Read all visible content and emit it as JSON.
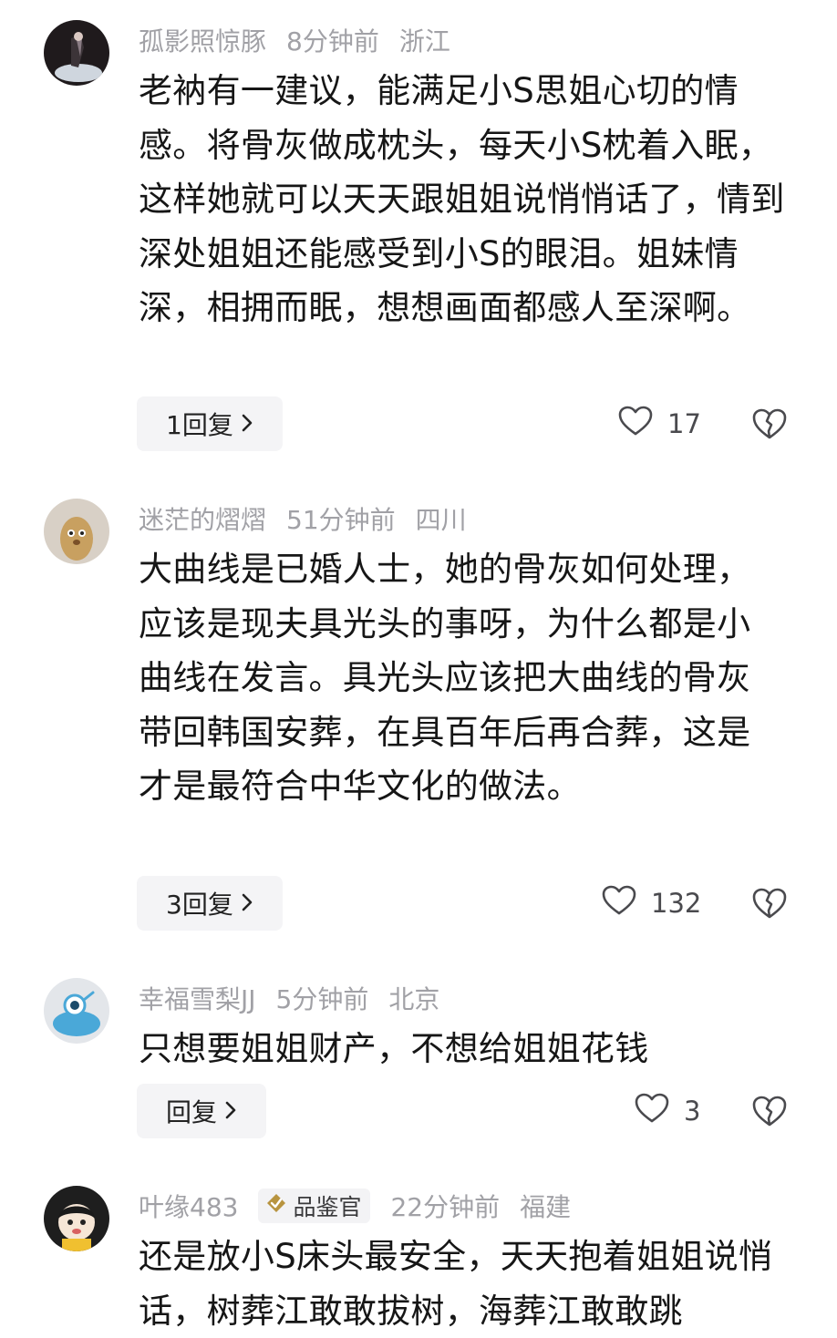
{
  "comments": [
    {
      "username": "孤影照惊豚",
      "time": "8分钟前",
      "location": "浙江",
      "text": "老衲有一建议，能满足小S思姐心切的情感。将骨灰做成枕头，每天小S枕着入眠，这样她就可以天天跟姐姐说悄悄话了，情到深处姐姐还能感受到小S的眼泪。姐妹情深，相拥而眠，想想画面都感人至深啊。",
      "reply_label": "1回复",
      "likes": "17"
    },
    {
      "username": "迷茫的熠熠",
      "time": "51分钟前",
      "location": "四川",
      "text": "大曲线是已婚人士，她的骨灰如何处理，应该是现夫具光头的事呀，为什么都是小曲线在发言。具光头应该把大曲线的骨灰带回韩国安葬，在具百年后再合葬，这是才是最符合中华文化的做法。",
      "reply_label": "3回复",
      "likes": "132"
    },
    {
      "username": "幸福雪梨JJ",
      "time": "5分钟前",
      "location": "北京",
      "text": "只想要姐姐财产，不想给姐姐花钱",
      "reply_label": "回复",
      "likes": "3"
    },
    {
      "username": "叶缘483",
      "badge": "品鉴官",
      "time": "22分钟前",
      "location": "福建",
      "text": "还是放小S床头最安全，天天抱着姐姐说悄话，树葬江敢敢拔树，海葬江敢敢跳"
    }
  ],
  "icons": {
    "like": "heart-outline-icon",
    "dislike": "broken-heart-icon",
    "reply_chevron": "chevron-right-icon",
    "badge": "gold-diamond-badge-icon"
  },
  "colors": {
    "meta_text": "#a1a1a6",
    "body_text": "#161616",
    "button_bg": "#f4f4f6"
  }
}
